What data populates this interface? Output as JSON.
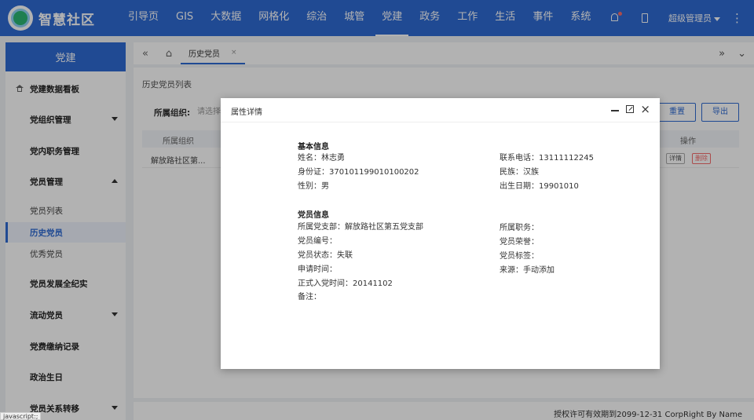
{
  "app": {
    "title": "智慧社区"
  },
  "nav": {
    "items": [
      "引导页",
      "GIS",
      "大数据",
      "网格化",
      "综治",
      "城管",
      "党建",
      "政务",
      "工作",
      "生活",
      "事件",
      "系统"
    ],
    "active": "党建"
  },
  "header": {
    "user": "超级管理员"
  },
  "sidebar": {
    "title": "党建",
    "items": [
      {
        "label": "党建数据看板"
      },
      {
        "label": "党组织管理"
      },
      {
        "label": "党内职务管理"
      },
      {
        "label": "党员管理"
      },
      {
        "label": "党员发展全纪实"
      },
      {
        "label": "流动党员"
      },
      {
        "label": "党费缴纳记录"
      },
      {
        "label": "政治生日"
      },
      {
        "label": "党员关系转移"
      }
    ],
    "subitems": [
      {
        "label": "党员列表"
      },
      {
        "label": "历史党员"
      },
      {
        "label": "优秀党员"
      }
    ]
  },
  "tabs": {
    "active_label": "历史党员",
    "close": "×"
  },
  "page": {
    "breadcrumb": "历史党员列表",
    "filter_label": "所属组织:",
    "filter_placeholder": "请选择",
    "reset_label": "重置",
    "export_label": "导出",
    "table": {
      "headers": {
        "org": "所属组织",
        "op": "操作"
      },
      "row": {
        "org": "解放路社区第...",
        "detail": "详情",
        "delete": "删除"
      }
    }
  },
  "modal": {
    "title": "属性详情",
    "basic": {
      "title": "基本信息",
      "left": [
        "姓名：林志勇",
        "身份证：370101199010100202",
        "性别：男"
      ],
      "right": [
        "联系电话：13111112245",
        "民族：汉族",
        "出生日期：19901010"
      ]
    },
    "member": {
      "title": "党员信息",
      "left": [
        "所属党支部：解放路社区第五党支部",
        "党员编号：",
        "党员状态：失联",
        "申请时间：",
        "正式入党时间：20141102",
        "备注："
      ],
      "right": [
        "所属职务：",
        "党员荣誉：",
        "党员标签：",
        "来源：手动添加"
      ]
    }
  },
  "footer": {
    "text": "授权许可有效期到2099-12-31 CorpRight By Name"
  },
  "statusbar": {
    "text": "javascript:;"
  },
  "colors": {
    "primary": "#2f6bd3",
    "danger": "#f56c6c"
  }
}
